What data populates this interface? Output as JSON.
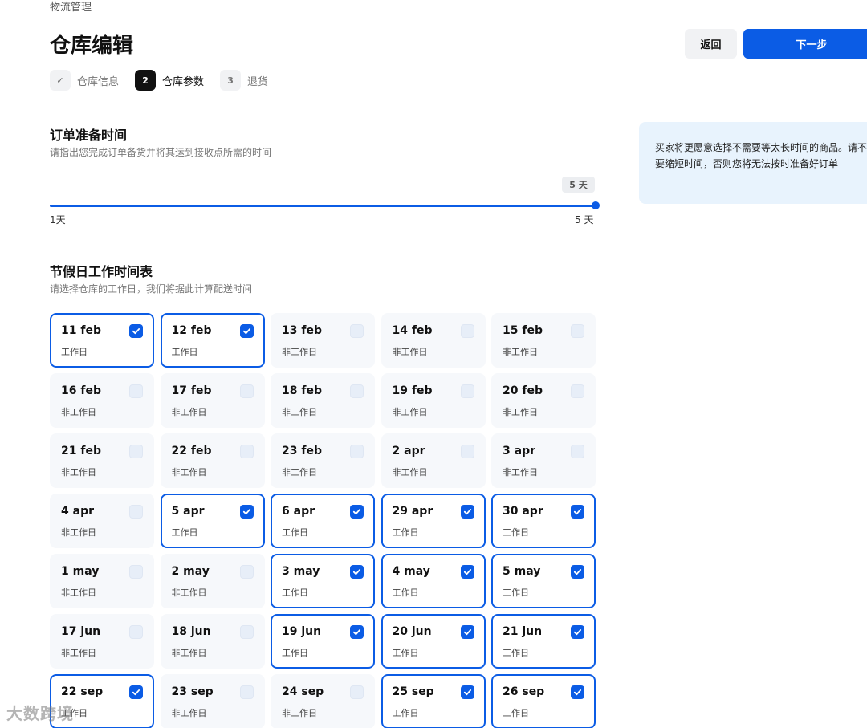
{
  "breadcrumb": "物流管理",
  "title": "仓库编辑",
  "buttons": {
    "back": "返回",
    "next": "下一步"
  },
  "steps": [
    {
      "badge": "✓",
      "label": "仓库信息",
      "state": "done"
    },
    {
      "badge": "2",
      "label": "仓库参数",
      "state": "active"
    },
    {
      "badge": "3",
      "label": "退货",
      "state": "todo"
    }
  ],
  "prep": {
    "title": "订单准备时间",
    "subtitle": "请指出您完成订单备货并将其运到接收点所需的时间",
    "value_label": "5 天",
    "value": 5,
    "min_label": "1天",
    "max_label": "5 天"
  },
  "tip": "买家将更愿意选择不需要等太长时间的商品。请不要缩短时间，否则您将无法按时准备好订单",
  "holiday": {
    "title": "节假日工作时间表",
    "subtitle": "请选择仓库的工作日，我们将据此计算配送时间",
    "days": [
      {
        "date": "11 feb",
        "status": "工作日",
        "checked": true
      },
      {
        "date": "12 feb",
        "status": "工作日",
        "checked": true
      },
      {
        "date": "13 feb",
        "status": "非工作日",
        "checked": false
      },
      {
        "date": "14 feb",
        "status": "非工作日",
        "checked": false
      },
      {
        "date": "15 feb",
        "status": "非工作日",
        "checked": false
      },
      {
        "date": "16 feb",
        "status": "非工作日",
        "checked": false
      },
      {
        "date": "17 feb",
        "status": "非工作日",
        "checked": false
      },
      {
        "date": "18 feb",
        "status": "非工作日",
        "checked": false
      },
      {
        "date": "19 feb",
        "status": "非工作日",
        "checked": false
      },
      {
        "date": "20 feb",
        "status": "非工作日",
        "checked": false
      },
      {
        "date": "21 feb",
        "status": "非工作日",
        "checked": false
      },
      {
        "date": "22 feb",
        "status": "非工作日",
        "checked": false
      },
      {
        "date": "23 feb",
        "status": "非工作日",
        "checked": false
      },
      {
        "date": "2 apr",
        "status": "非工作日",
        "checked": false
      },
      {
        "date": "3 apr",
        "status": "非工作日",
        "checked": false
      },
      {
        "date": "4 apr",
        "status": "非工作日",
        "checked": false
      },
      {
        "date": "5 apr",
        "status": "工作日",
        "checked": true
      },
      {
        "date": "6 apr",
        "status": "工作日",
        "checked": true
      },
      {
        "date": "29 apr",
        "status": "工作日",
        "checked": true
      },
      {
        "date": "30 apr",
        "status": "工作日",
        "checked": true
      },
      {
        "date": "1 may",
        "status": "非工作日",
        "checked": false
      },
      {
        "date": "2 may",
        "status": "非工作日",
        "checked": false
      },
      {
        "date": "3 may",
        "status": "工作日",
        "checked": true
      },
      {
        "date": "4 may",
        "status": "工作日",
        "checked": true
      },
      {
        "date": "5 may",
        "status": "工作日",
        "checked": true
      },
      {
        "date": "17 jun",
        "status": "非工作日",
        "checked": false
      },
      {
        "date": "18 jun",
        "status": "非工作日",
        "checked": false
      },
      {
        "date": "19 jun",
        "status": "工作日",
        "checked": true
      },
      {
        "date": "20 jun",
        "status": "工作日",
        "checked": true
      },
      {
        "date": "21 jun",
        "status": "工作日",
        "checked": true
      },
      {
        "date": "22 sep",
        "status": "工作日",
        "checked": true
      },
      {
        "date": "23 sep",
        "status": "非工作日",
        "checked": false
      },
      {
        "date": "24 sep",
        "status": "非工作日",
        "checked": false
      },
      {
        "date": "25 sep",
        "status": "工作日",
        "checked": true
      },
      {
        "date": "26 sep",
        "status": "工作日",
        "checked": true
      }
    ]
  },
  "watermark": "大数跨境",
  "colors": {
    "accent": "#0b5ce5",
    "tip_bg": "#e8f3fd"
  }
}
